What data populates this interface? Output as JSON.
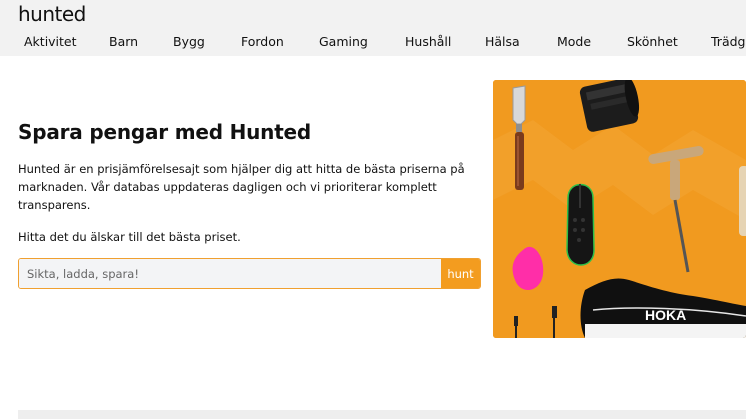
{
  "header": {
    "logo_text": "hunted",
    "nav": [
      {
        "label": "Aktivitet"
      },
      {
        "label": "Barn"
      },
      {
        "label": "Bygg"
      },
      {
        "label": "Fordon"
      },
      {
        "label": "Gaming"
      },
      {
        "label": "Hushåll"
      },
      {
        "label": "Hälsa"
      },
      {
        "label": "Mode"
      },
      {
        "label": "Skönhet"
      },
      {
        "label": "Trädgård"
      }
    ]
  },
  "hero": {
    "title": "Spara pengar med Hunted",
    "description": "Hunted är en prisjämförelsesajt som hjälper dig att hitta de bästa priserna på marknaden. Vår databas uppdateras dagligen och vi prioriterar komplett transparens.",
    "cta": "Hitta det du älskar till det bästa priset.",
    "search": {
      "placeholder": "Sikta, ladda, spara!",
      "value": "",
      "button_label": "hunt"
    },
    "image": {
      "background_color": "#f19a1f",
      "shoe_brand_text": "HOKA",
      "items": [
        "spatula",
        "camera-lens",
        "gaming-mouse",
        "corkscrew",
        "makeup-sponge",
        "usb-cable",
        "running-shoe"
      ]
    }
  },
  "colors": {
    "accent": "#f39c1f",
    "header_bg": "#f2f2f2"
  }
}
